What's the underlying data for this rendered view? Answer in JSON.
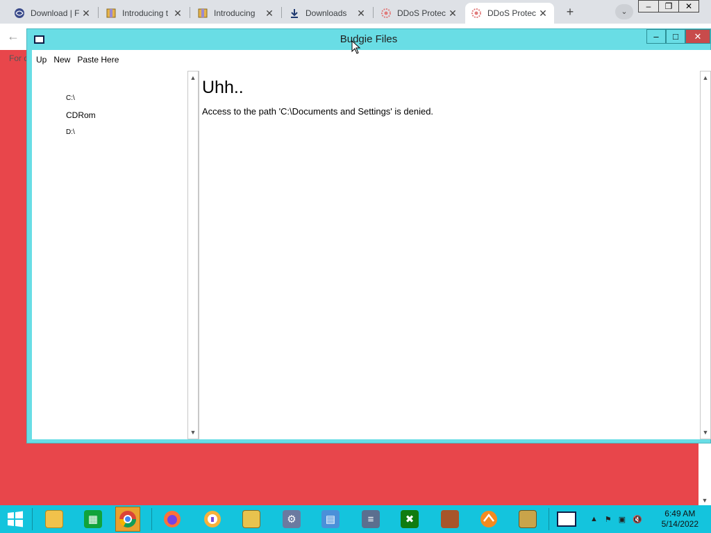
{
  "browser": {
    "tabs": [
      {
        "title": "Download | F",
        "icon": "globe-icon"
      },
      {
        "title": "Introducing t",
        "icon": "archive-icon"
      },
      {
        "title": "Introducing",
        "icon": "archive-icon"
      },
      {
        "title": "Downloads",
        "icon": "download-icon"
      },
      {
        "title": "DDoS Protec",
        "icon": "shield-icon"
      },
      {
        "title": "DDoS Protec",
        "icon": "shield-icon"
      }
    ],
    "bookmark_fragment": "For q",
    "window_controls": [
      "–",
      "❐",
      "✕"
    ]
  },
  "budgie": {
    "title": "Budgie Files",
    "menu": [
      "Up",
      "New",
      "Paste Here"
    ],
    "drives": [
      "C:\\",
      "CDRom",
      "D:\\"
    ],
    "error_heading": "Uhh..",
    "error_message": "Access to the path 'C:\\Documents and Settings' is denied.",
    "controls": {
      "min": "–",
      "max": "□",
      "close": "✕"
    }
  },
  "taskbar": {
    "apps": [
      "start-button",
      "file-explorer",
      "store",
      "chrome",
      "firefox",
      "vpn-app",
      "archive-app",
      "settings-app",
      "network-app",
      "server-app",
      "xbox-app",
      "game-app",
      "spark-app",
      "winrar-app",
      "window-app"
    ],
    "clock_time": "6:49 AM",
    "clock_date": "5/14/2022"
  }
}
